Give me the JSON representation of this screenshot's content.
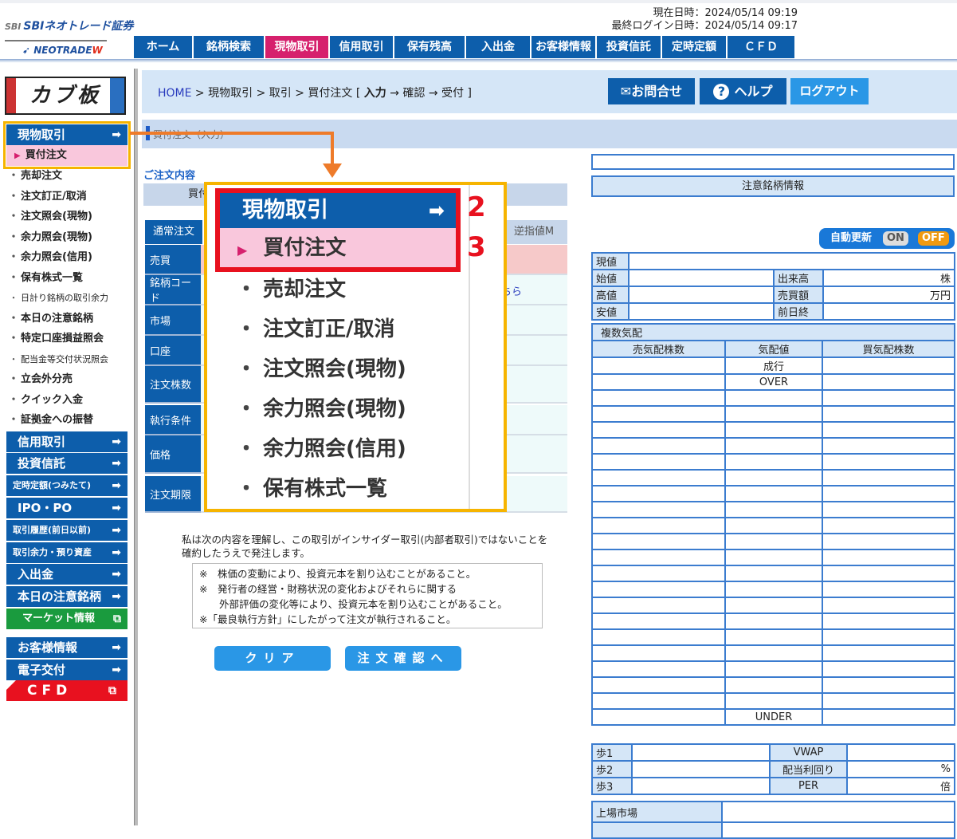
{
  "logo": {
    "brand": "SBIネオトレード証券",
    "brand_mark": "SBI",
    "product_prefix": "NEOTRADE",
    "product_suffix": "W",
    "kabuita": "カブ板"
  },
  "datetime": {
    "current": "現在日時：2024/05/14 09:19",
    "last_login": "最終ログイン日時：2024/05/14 09:17"
  },
  "nav": [
    "ホーム",
    "銘柄検索",
    "現物取引",
    "信用取引",
    "保有残高",
    "入出金",
    "お客様情報",
    "投資信託",
    "定時定額",
    "ＣＦＤ"
  ],
  "breadcrumb": {
    "home": "HOME",
    "rest": " > 現物取引 > 取引 > 買付注文 [ ",
    "step1": "入力",
    "rest2": " → 確認 → 受付 ]"
  },
  "header_buttons": {
    "contact": "✉お問合せ",
    "help": "ヘルプ",
    "logout": "ログアウト"
  },
  "section_title": "買付注文（入力）",
  "sidebar": {
    "head": "現物取引",
    "arrow": "➡",
    "selected": "買付注文",
    "items": [
      {
        "label": "売却注文"
      },
      {
        "label": "注文訂正/取消"
      },
      {
        "label": "注文照会(現物)"
      },
      {
        "label": "余力照会(現物)"
      },
      {
        "label": "余力照会(信用)"
      },
      {
        "label": "保有株式一覧"
      },
      {
        "label": "日計り銘柄の取引余力",
        "small": true
      },
      {
        "label": "本日の注意銘柄"
      },
      {
        "label": "特定口座損益照会"
      },
      {
        "label": "配当金等交付状況照会",
        "small": true
      },
      {
        "label": "立会外分売"
      },
      {
        "label": "クイック入金"
      },
      {
        "label": "証拠金への振替"
      }
    ],
    "buttons": [
      {
        "label": "信用取引",
        "icon": "➡"
      },
      {
        "label": "投資信託",
        "icon": "➡"
      },
      {
        "label": "定時定額(つみたて)",
        "icon": "➡",
        "small": true
      },
      {
        "label": "IPO・PO",
        "icon": "➡"
      },
      {
        "label": "取引履歴(前日以前)",
        "icon": "➡",
        "small": true
      },
      {
        "label": "取引余力・預り資産",
        "icon": "➡",
        "small": true
      },
      {
        "label": "入出金",
        "icon": "➡"
      },
      {
        "label": "本日の注意銘柄",
        "icon": "➡"
      },
      {
        "label": "マーケット情報",
        "icon": "⧉",
        "color": "green"
      },
      {
        "label": "お客様情報",
        "icon": "➡"
      },
      {
        "label": "電子交付",
        "icon": "➡"
      },
      {
        "label": "CFD",
        "icon": "⧉",
        "color": "red"
      }
    ]
  },
  "order": {
    "label": "ご注文内容",
    "buy_row": "買付",
    "tabs": [
      "通常注文",
      "注文",
      "逆指値M"
    ],
    "rows": [
      "売買",
      "銘柄コード",
      "市場",
      "口座",
      "注文株数",
      "執行条件",
      "価格",
      "注文期限"
    ],
    "search_link": "索はこちら"
  },
  "overlay": {
    "head": "現物取引",
    "selected": "買付注文",
    "items": [
      "売却注文",
      "注文訂正/取消",
      "注文照会(現物)",
      "余力照会(現物)",
      "余力照会(信用)",
      "保有株式一覧"
    ],
    "step2": "2",
    "step3": "3"
  },
  "disclaimer": {
    "intro": "私は次の内容を理解し、この取引がインサイダー取引(内部者取引)ではないことを確約したうえで発注します。",
    "notes": [
      "※　株価の変動により、投資元本を割り込むことがあること。",
      "※　発行者の経営・財務状況の変化およびそれらに関する",
      "　　外部評価の変化等により、投資元本を割り込むことがあること。",
      "※「最良執行方針」にしたがって注文が執行されること。"
    ]
  },
  "buttons": {
    "clear": "クリア",
    "confirm": "注文確認へ"
  },
  "right": {
    "caution": "注意銘柄情報",
    "auto_update": {
      "label": "自動更新",
      "on": "ON",
      "off": "OFF",
      "state": "OFF"
    },
    "quote": {
      "current": "現値",
      "open": "始値",
      "high": "高値",
      "low": "安値",
      "volume": "出来高",
      "volume_unit": "株",
      "turnover": "売買額",
      "turnover_unit": "万円",
      "prev_close": "前日終"
    },
    "board": {
      "title": "複数気配",
      "ask": "売気配株数",
      "price": "気配値",
      "bid": "買気配株数",
      "market": "成行",
      "over": "OVER",
      "under": "UNDER"
    },
    "steps": {
      "s1": "歩1",
      "s2": "歩2",
      "s3": "歩3",
      "vwap": "VWAP",
      "yield": "配当利回り",
      "yield_unit": "%",
      "per": "PER",
      "per_unit": "倍"
    },
    "listing": "上場市場"
  },
  "colors": {
    "nav_blue": "#0d5eab",
    "active_pink": "#d6206d",
    "highlight_yellow": "#f6b400",
    "highlight_red": "#e8111f",
    "connector_orange": "#ee7b2a"
  }
}
